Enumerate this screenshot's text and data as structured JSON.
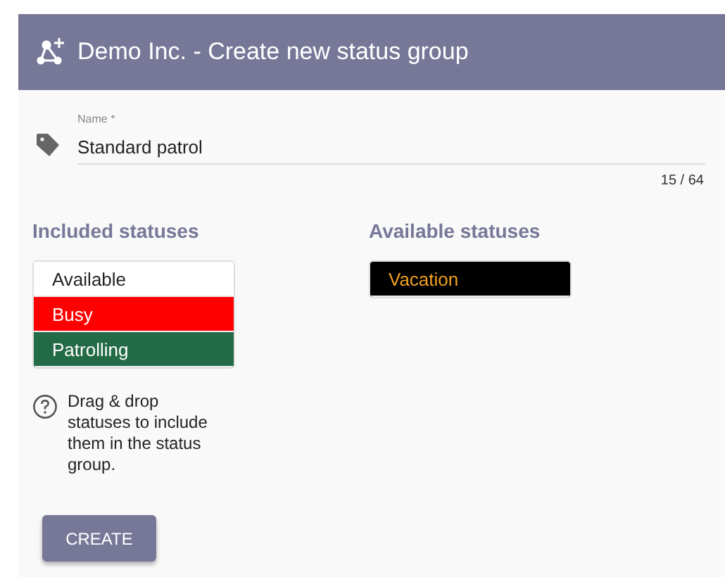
{
  "header": {
    "title": "Demo Inc. - Create new status group"
  },
  "name_field": {
    "label": "Name *",
    "value": "Standard patrol",
    "counter": "15 / 64"
  },
  "included": {
    "heading": "Included statuses",
    "statuses": [
      {
        "label": "Available",
        "color": "#ffffff"
      },
      {
        "label": "Busy",
        "color": "#ff0000"
      },
      {
        "label": "Patrolling",
        "color": "#236b46"
      }
    ]
  },
  "available": {
    "heading": "Available statuses",
    "statuses": [
      {
        "label": "Vacation",
        "color": "#000000"
      }
    ]
  },
  "help": {
    "text": "Drag & drop statuses to include them in the status group."
  },
  "create_button": {
    "label": "CREATE"
  }
}
